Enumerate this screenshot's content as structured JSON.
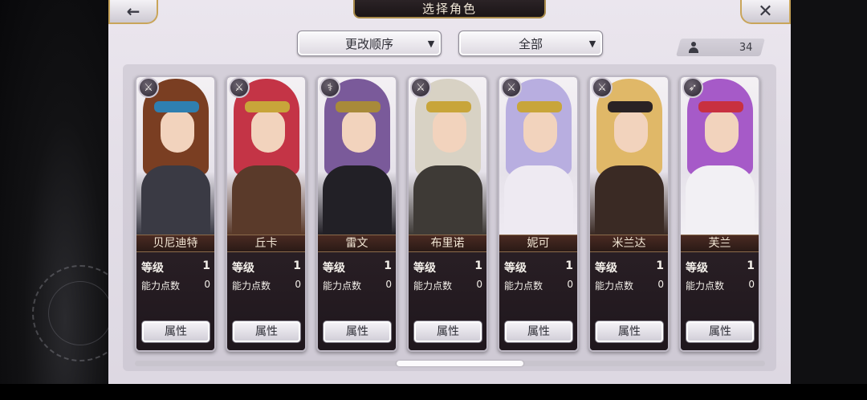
{
  "header": {
    "title": "选择角色",
    "back_icon": "arrow-left-icon",
    "close_icon": "close-icon"
  },
  "filters": {
    "order_label": "更改顺序",
    "category_label": "全部"
  },
  "roster": {
    "count": "34"
  },
  "cards": [
    {
      "name": "贝尼迪特",
      "level_label": "等级",
      "level": "1",
      "points_label": "能力点数",
      "points": "0",
      "button": "属性",
      "class_icon": "sword-icon",
      "colors": {
        "hair": "#7a3e22",
        "body": "#3a3a44",
        "acc": "#2f7fb0"
      }
    },
    {
      "name": "丘卡",
      "level_label": "等级",
      "level": "1",
      "points_label": "能力点数",
      "points": "0",
      "button": "属性",
      "class_icon": "sword-icon",
      "colors": {
        "hair": "#c43446",
        "body": "#5a3a2a",
        "acc": "#c8a53a"
      }
    },
    {
      "name": "雷文",
      "level_label": "等级",
      "level": "1",
      "points_label": "能力点数",
      "points": "0",
      "button": "属性",
      "class_icon": "staff-icon",
      "colors": {
        "hair": "#7a5a9a",
        "body": "#222026",
        "acc": "#a88a3a"
      }
    },
    {
      "name": "布里诺",
      "level_label": "等级",
      "level": "1",
      "points_label": "能力点数",
      "points": "0",
      "button": "属性",
      "class_icon": "sword-icon",
      "colors": {
        "hair": "#d8d2c4",
        "body": "#3e3a36",
        "acc": "#c8a53a"
      }
    },
    {
      "name": "妮可",
      "level_label": "等级",
      "level": "1",
      "points_label": "能力点数",
      "points": "0",
      "button": "属性",
      "class_icon": "sword-icon",
      "colors": {
        "hair": "#b8aee0",
        "body": "#eeeaf2",
        "acc": "#c8a53a"
      }
    },
    {
      "name": "米兰达",
      "level_label": "等级",
      "level": "1",
      "points_label": "能力点数",
      "points": "0",
      "button": "属性",
      "class_icon": "sword-icon",
      "colors": {
        "hair": "#e0b868",
        "body": "#3a2a24",
        "acc": "#2a2224"
      }
    },
    {
      "name": "芙兰",
      "level_label": "等级",
      "level": "1",
      "points_label": "能力点数",
      "points": "0",
      "button": "属性",
      "class_icon": "bow-icon",
      "colors": {
        "hair": "#a65ac8",
        "body": "#f2f0f4",
        "acc": "#c83040"
      }
    }
  ]
}
